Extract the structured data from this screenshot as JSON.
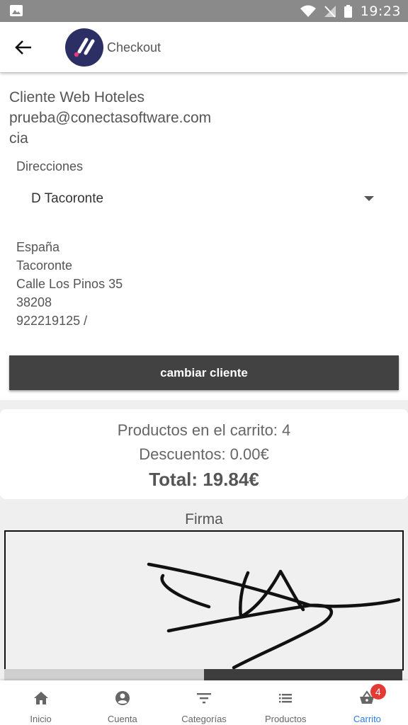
{
  "status_bar": {
    "time": "19:23"
  },
  "header": {
    "title": "Checkout"
  },
  "client": {
    "name": "Cliente Web Hoteles",
    "email": "prueba@conectasoftware.com",
    "company": "cia",
    "addresses_label": "Direcciones",
    "selected_address": "D Tacoronte",
    "address": {
      "country": "España",
      "city": "Tacoronte",
      "street": "Calle Los Pinos 35",
      "postal_code": "38208",
      "phone": "922219125 /"
    },
    "change_button": "cambiar cliente"
  },
  "summary": {
    "products": "Productos en el carrito: 4",
    "discounts": "Descuentos: 0.00€",
    "total": "Total: 19.84€"
  },
  "signature": {
    "label": "Firma"
  },
  "bottom_nav": {
    "items": [
      {
        "label": "Inicio",
        "icon": "home-icon"
      },
      {
        "label": "Cuenta",
        "icon": "account-icon"
      },
      {
        "label": "Categorías",
        "icon": "filter-icon"
      },
      {
        "label": "Productos",
        "icon": "list-icon"
      },
      {
        "label": "Carrito",
        "icon": "basket-icon",
        "badge": "4",
        "active": true
      }
    ]
  },
  "colors": {
    "accent": "#2d7be5",
    "button": "#424242",
    "badge": "#e53935",
    "logo": "#2b2f63"
  }
}
